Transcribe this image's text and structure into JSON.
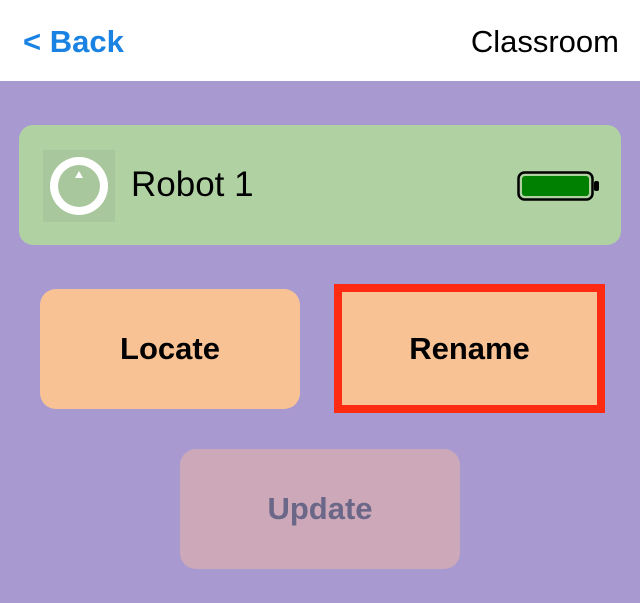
{
  "nav": {
    "back_label": "< Back",
    "title": "Classroom"
  },
  "robot": {
    "name": "Robot 1",
    "avatar_icon": "robot-avatar-icon",
    "battery_icon": "battery-full-icon",
    "battery_level": 1.0,
    "battery_color": "#008000"
  },
  "actions": {
    "locate_label": "Locate",
    "rename_label": "Rename",
    "update_label": "Update",
    "update_enabled": false
  },
  "colors": {
    "background": "#a899d1",
    "nav_background": "#ffffff",
    "link": "#1a82e2",
    "card": "#b0d2a3",
    "button": "#f9c294",
    "highlight_border": "#ff2a12",
    "disabled_button": "#cca8b8",
    "disabled_text": "#6b6788"
  }
}
